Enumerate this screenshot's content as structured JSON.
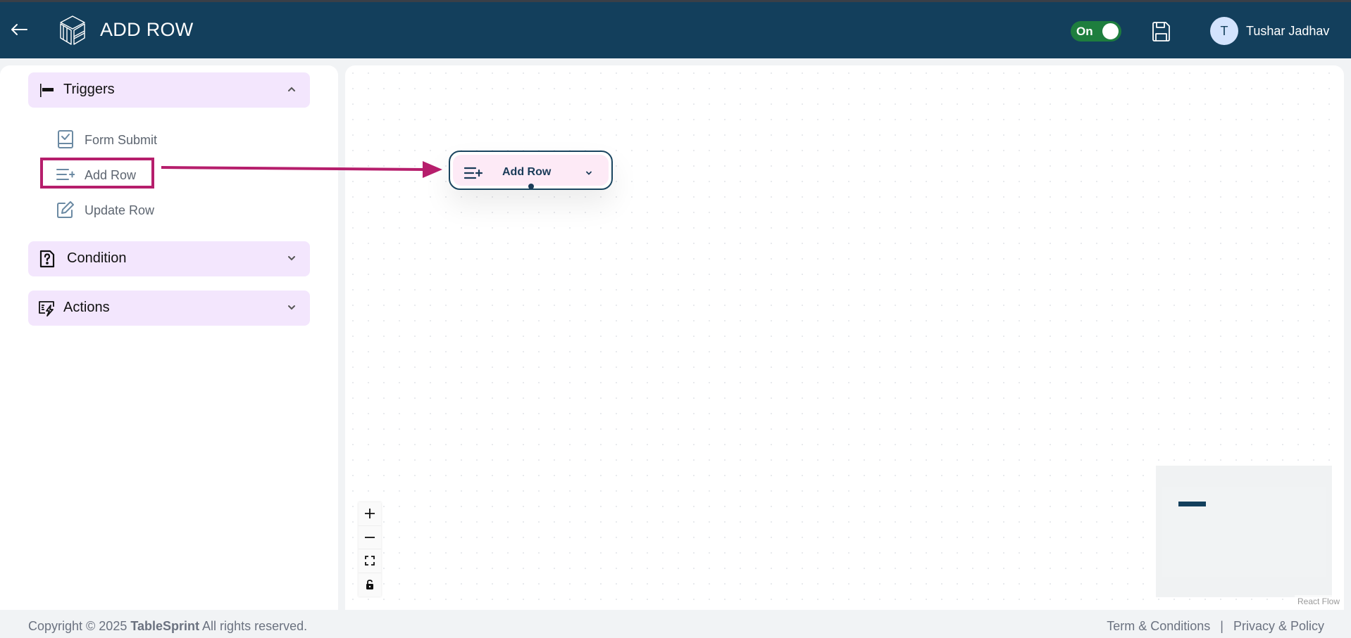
{
  "header": {
    "title": "ADD ROW",
    "toggle_label": "On",
    "toggle_state": "on",
    "user_initial": "T",
    "user_name": "Tushar Jadhav",
    "colors": {
      "background": "#133f5c",
      "toggle_on": "#1e7e3e"
    }
  },
  "sidebar": {
    "sections": [
      {
        "label": "Triggers",
        "expanded": true,
        "icon": "flag-icon",
        "items": [
          {
            "label": "Form Submit",
            "icon": "form-check-icon"
          },
          {
            "label": "Add Row",
            "icon": "list-add-icon",
            "highlighted": true
          },
          {
            "label": "Update Row",
            "icon": "edit-icon"
          }
        ]
      },
      {
        "label": "Condition",
        "expanded": false,
        "icon": "question-file-icon"
      },
      {
        "label": "Actions",
        "expanded": false,
        "icon": "action-bolt-icon"
      }
    ]
  },
  "canvas": {
    "node": {
      "label": "Add Row",
      "icon": "list-add-icon"
    },
    "annotation_color": "#b61e6c",
    "controls": [
      "zoom-in",
      "zoom-out",
      "fit-view",
      "toggle-interactivity"
    ],
    "attribution": "React Flow"
  },
  "footer": {
    "copyright_prefix": "Copyright © 2025 ",
    "brand": "TableSprint",
    "copyright_suffix": " All rights reserved.",
    "links": [
      "Term & Conditions",
      "Privacy & Policy"
    ],
    "separator": "|"
  }
}
